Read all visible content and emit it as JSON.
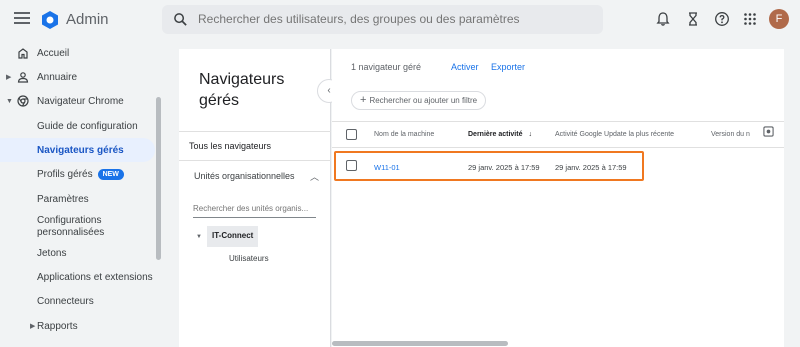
{
  "header": {
    "app_title": "Admin",
    "search_placeholder": "Rechercher des utilisateurs, des groupes ou des paramètres",
    "avatar_initial": "F"
  },
  "sidebar": {
    "items": [
      {
        "label": "Accueil",
        "icon": "home-icon"
      },
      {
        "label": "Annuaire",
        "icon": "person-icon"
      },
      {
        "label": "Navigateur Chrome",
        "icon": "chrome-icon"
      },
      {
        "label": "Guide de configuration"
      },
      {
        "label": "Navigateurs gérés"
      },
      {
        "label": "Profils gérés",
        "badge": "NEW"
      },
      {
        "label": "Paramètres"
      },
      {
        "label": "Configurations personnalisées"
      },
      {
        "label": "Jetons"
      },
      {
        "label": "Applications et extensions"
      },
      {
        "label": "Connecteurs"
      },
      {
        "label": "Rapports"
      }
    ]
  },
  "left_panel": {
    "title": "Navigateurs gérés",
    "tab_all": "Tous les navigateurs",
    "org_units_label": "Unités organisationnelles",
    "org_search_placeholder": "Rechercher des unités organis...",
    "tree_root": "IT-Connect",
    "tree_child": "Utilisateurs"
  },
  "main": {
    "managed_count": "1 navigateur géré",
    "activate_link": "Activer",
    "export_link": "Exporter",
    "filter_placeholder": "Rechercher ou ajouter un filtre",
    "columns": [
      "Nom de la machine",
      "Dernière activité",
      "Activité Google Update la plus récente",
      "Version du n"
    ],
    "rows": [
      {
        "machine": "W11-01",
        "last_activity": "29 janv. 2025 à 17:59",
        "google_update": "29 janv. 2025 à 17:59"
      }
    ]
  },
  "colors": {
    "accent": "#1a73e8",
    "highlight_box": "#f07820",
    "active_nav_bg": "#e8f0fe"
  }
}
